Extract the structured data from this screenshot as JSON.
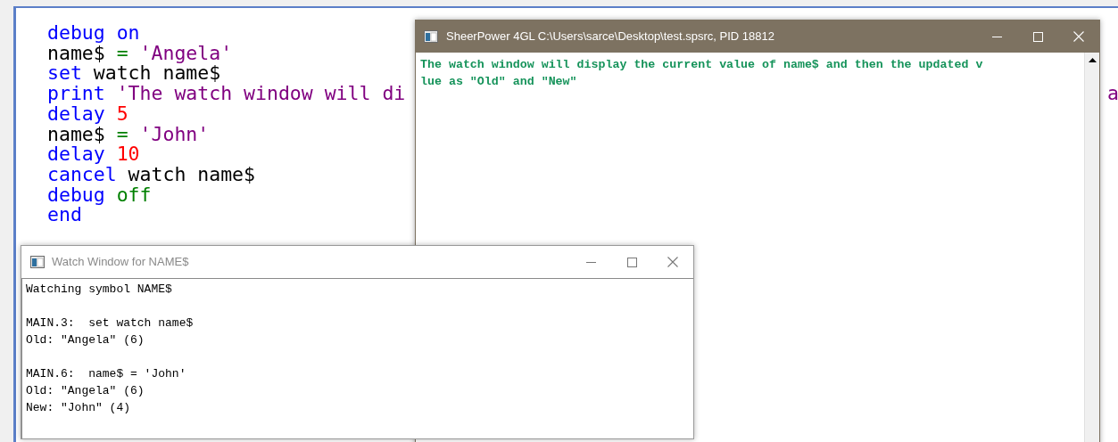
{
  "editor": {
    "lines": [
      [
        {
          "kind": "keyword",
          "text": "debug"
        },
        {
          "kind": "keyword",
          "text": " on"
        }
      ],
      [
        {
          "kind": "text",
          "text": "name$ "
        },
        {
          "kind": "operator",
          "text": "="
        },
        {
          "kind": "string",
          "text": " 'Angela'"
        }
      ],
      [
        {
          "kind": "keyword",
          "text": "set"
        },
        {
          "kind": "text",
          "text": " watch name$"
        }
      ],
      [
        {
          "kind": "keyword",
          "text": "print"
        },
        {
          "kind": "string",
          "text": " 'The watch window will di"
        }
      ],
      [
        {
          "kind": "keyword",
          "text": "delay"
        },
        {
          "kind": "number",
          "text": " 5"
        }
      ],
      [
        {
          "kind": "text",
          "text": "name$ "
        },
        {
          "kind": "operator",
          "text": "="
        },
        {
          "kind": "string",
          "text": " 'John'"
        }
      ],
      [
        {
          "kind": "keyword",
          "text": "delay"
        },
        {
          "kind": "number",
          "text": " 10"
        }
      ],
      [
        {
          "kind": "keyword",
          "text": "cancel"
        },
        {
          "kind": "text",
          "text": " watch name$"
        }
      ],
      [
        {
          "kind": "keyword",
          "text": "debug"
        },
        {
          "kind": "operator",
          "text": " off"
        }
      ],
      [
        {
          "kind": "keyword",
          "text": "end"
        }
      ]
    ],
    "edge_fragment": "a"
  },
  "console_window": {
    "title": "SheerPower 4GL C:\\Users\\sarce\\Desktop\\test.spsrc, PID 18812",
    "active": true,
    "lines": [
      "The watch window will display the current value of name$ and then the updated v",
      "lue as \"Old\" and \"New\""
    ]
  },
  "watch_window": {
    "title": "Watch Window for NAME$",
    "active": false,
    "blocks": [
      [
        "Watching symbol NAME$"
      ],
      [
        "MAIN.3:  set watch name$",
        "Old: \"Angela\" (6)"
      ],
      [
        "MAIN.6:  name$ = 'John'",
        "Old: \"Angela\" (6)",
        "New: \"John\" (4)"
      ]
    ]
  }
}
